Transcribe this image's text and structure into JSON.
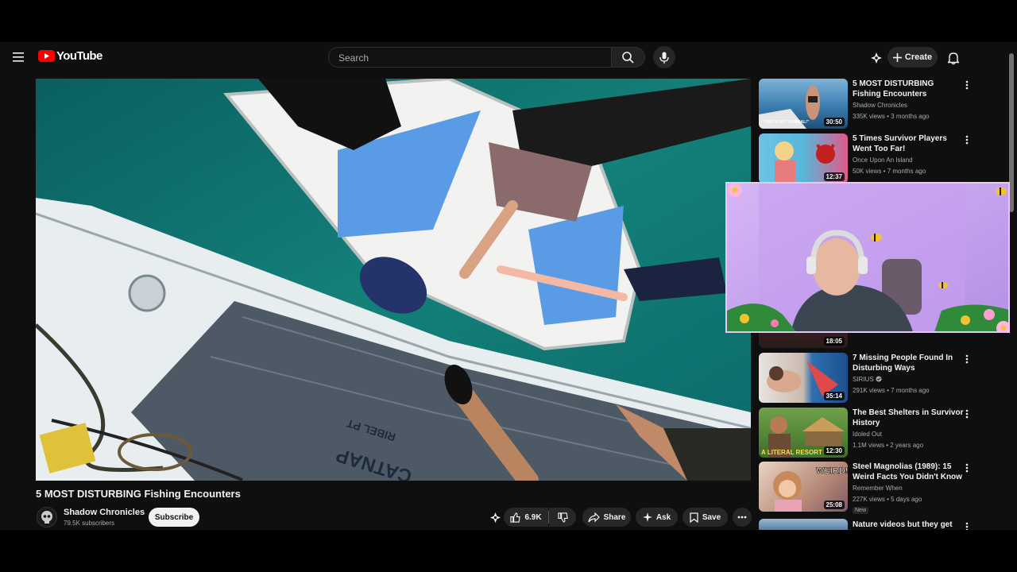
{
  "header": {
    "logo_text": "YouTube",
    "search_placeholder": "Search",
    "create_label": "Create"
  },
  "video": {
    "title": "5 MOST DISTURBING Fishing Encounters",
    "boat_text": "CATNAP",
    "boat_subtext": "RIBEL PT",
    "channel": {
      "name": "Shadow Chronicles",
      "subscribers": "79.5K subscribers",
      "subscribe_label": "Subscribe"
    },
    "actions": {
      "likes": "6.9K",
      "share_label": "Share",
      "ask_label": "Ask",
      "save_label": "Save"
    }
  },
  "recommendations": [
    {
      "title": "5 MOST DISTURBING Fishing Encounters",
      "channel": "Shadow Chronicles",
      "meta": "335K views • 3 months ago",
      "duration": "30:50",
      "thumb_caption": "\"THAT'S NOT NORMAL!\""
    },
    {
      "title": "5 Times Survivor Players Went Too Far!",
      "channel": "Once Upon An Island",
      "meta": "50K views • 7 months ago",
      "duration": "12:37"
    },
    {
      "duration": "18:05"
    },
    {
      "title": "7 Missing People Found In Disturbing Ways",
      "channel": "SIRIUS",
      "meta": "291K views • 7 months ago",
      "duration": "35:14"
    },
    {
      "title": "The Best Shelters in Survivor History",
      "channel": "Idoled Out",
      "meta": "1.1M views • 2 years ago",
      "duration": "12:30",
      "thumb_caption": "A LITERAL RESORT"
    },
    {
      "title": "Steel Magnolias (1989): 15 Weird Facts You Didn't Know",
      "channel": "Remember When",
      "meta": "227K views • 5 days ago",
      "duration": "25:08",
      "badge": "New",
      "thumb_caption": "WEIRD!"
    },
    {
      "title": "Nature videos but they get"
    }
  ],
  "colors": {
    "background": "#0f0f0f",
    "brand_red": "#ff0000",
    "pill": "#272727",
    "water": "#0e6f6b",
    "overlay_lavender": "#c7a5ee"
  }
}
